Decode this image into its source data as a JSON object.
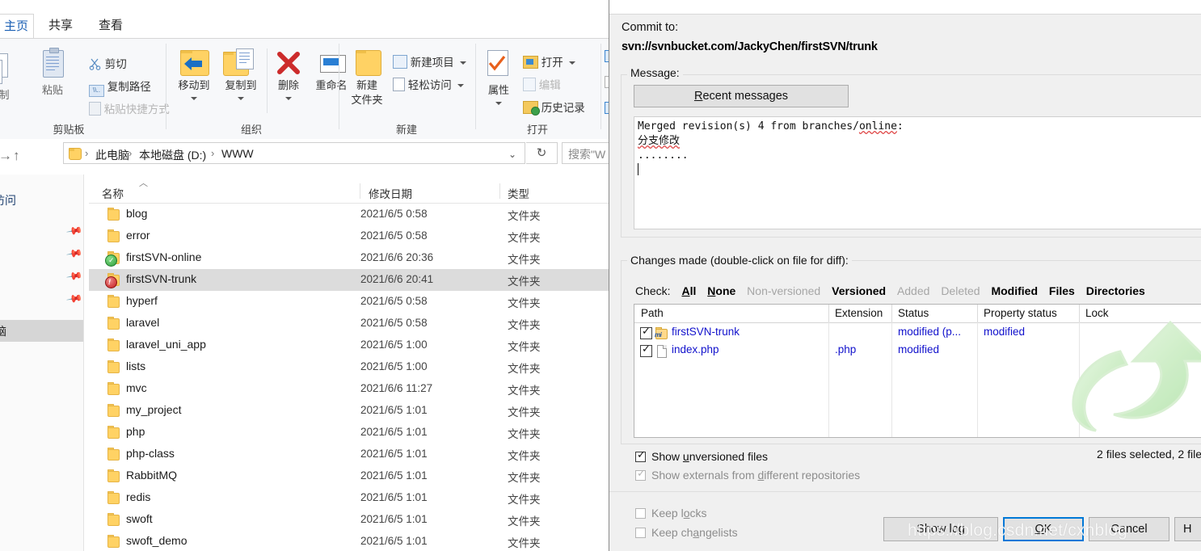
{
  "explorer": {
    "tabs": [
      {
        "id": "home",
        "label": "主页",
        "active": true
      },
      {
        "id": "share",
        "label": "共享",
        "active": false
      },
      {
        "id": "view",
        "label": "查看",
        "active": false
      }
    ],
    "ribbon_groups": [
      {
        "name": "clipboard",
        "label": "剪贴板"
      },
      {
        "name": "organize",
        "label": "组织"
      },
      {
        "name": "new",
        "label": "新建"
      },
      {
        "name": "open",
        "label": "打开"
      }
    ],
    "ribbon_buttons": {
      "copy": "制",
      "paste": "粘贴",
      "cut": "剪切",
      "copy_path": "复制路径",
      "paste_shortcut": "粘贴快捷方式",
      "move_to": "移动到",
      "copy_to": "复制到",
      "delete": "删除",
      "rename": "重命名",
      "new_folder_l1": "新建",
      "new_folder_l2": "文件夹",
      "new_item": "新建项目",
      "easy_access": "轻松访问",
      "properties": "属性",
      "open": "打开",
      "edit": "编辑",
      "history": "历史记录"
    },
    "addressbar": {
      "breadcrumbs": [
        "此电脑",
        "本地磁盘 (D:)",
        "WWW"
      ],
      "separator": "›",
      "chevron": "⌄",
      "refresh_glyph": "↻",
      "search_placeholder": "搜索\"W"
    },
    "columns": [
      "名称",
      "修改日期",
      "类型"
    ],
    "nav_pane": {
      "header": "访问",
      "selected_item": "脑"
    },
    "files": [
      {
        "name": "blog",
        "date": "2021/6/5 0:58",
        "type": "文件夹",
        "overlay": "none",
        "selected": false
      },
      {
        "name": "error",
        "date": "2021/6/5 0:58",
        "type": "文件夹",
        "overlay": "none",
        "selected": false
      },
      {
        "name": "firstSVN-online",
        "date": "2021/6/6 20:36",
        "type": "文件夹",
        "overlay": "green",
        "selected": false
      },
      {
        "name": "firstSVN-trunk",
        "date": "2021/6/6 20:41",
        "type": "文件夹",
        "overlay": "red",
        "selected": true
      },
      {
        "name": "hyperf",
        "date": "2021/6/5 0:58",
        "type": "文件夹",
        "overlay": "none",
        "selected": false
      },
      {
        "name": "laravel",
        "date": "2021/6/5 0:58",
        "type": "文件夹",
        "overlay": "none",
        "selected": false
      },
      {
        "name": "laravel_uni_app",
        "date": "2021/6/5 1:00",
        "type": "文件夹",
        "overlay": "none",
        "selected": false
      },
      {
        "name": "lists",
        "date": "2021/6/5 1:00",
        "type": "文件夹",
        "overlay": "none",
        "selected": false
      },
      {
        "name": "mvc",
        "date": "2021/6/6 11:27",
        "type": "文件夹",
        "overlay": "none",
        "selected": false
      },
      {
        "name": "my_project",
        "date": "2021/6/5 1:01",
        "type": "文件夹",
        "overlay": "none",
        "selected": false
      },
      {
        "name": "php",
        "date": "2021/6/5 1:01",
        "type": "文件夹",
        "overlay": "none",
        "selected": false
      },
      {
        "name": "php-class",
        "date": "2021/6/5 1:01",
        "type": "文件夹",
        "overlay": "none",
        "selected": false
      },
      {
        "name": "RabbitMQ",
        "date": "2021/6/5 1:01",
        "type": "文件夹",
        "overlay": "none",
        "selected": false
      },
      {
        "name": "redis",
        "date": "2021/6/5 1:01",
        "type": "文件夹",
        "overlay": "none",
        "selected": false
      },
      {
        "name": "swoft",
        "date": "2021/6/5 1:01",
        "type": "文件夹",
        "overlay": "none",
        "selected": false
      },
      {
        "name": "swoft_demo",
        "date": "2021/6/5 1:01",
        "type": "文件夹",
        "overlay": "none",
        "selected": false
      }
    ]
  },
  "svn_dialog": {
    "commit_to_label": "Commit to:",
    "commit_to_url": "svn://svnbucket.com/JackyChen/firstSVN/trunk",
    "message_group_title": "Message:",
    "recent_messages_button": "Recent messages",
    "message_lines": [
      "Merged revision(s) 4 from branches/online:",
      "分支修改",
      "........"
    ],
    "changes_group_title": "Changes made (double-click on file for diff):",
    "check_label": "Check:",
    "check_links": [
      {
        "label": "All",
        "enabled": true,
        "accel": "A"
      },
      {
        "label": "None",
        "enabled": true,
        "accel": "N"
      },
      {
        "label": "Non-versioned",
        "enabled": false,
        "accel": ""
      },
      {
        "label": "Versioned",
        "enabled": true,
        "accel": ""
      },
      {
        "label": "Added",
        "enabled": false,
        "accel": ""
      },
      {
        "label": "Deleted",
        "enabled": false,
        "accel": ""
      },
      {
        "label": "Modified",
        "enabled": true,
        "accel": ""
      },
      {
        "label": "Files",
        "enabled": true,
        "accel": ""
      },
      {
        "label": "Directories",
        "enabled": true,
        "accel": ""
      }
    ],
    "list_columns": [
      "Path",
      "Extension",
      "Status",
      "Property status",
      "Lock"
    ],
    "list_rows": [
      {
        "checked": true,
        "icon": "folder-modified",
        "path": "firstSVN-trunk",
        "extension": "",
        "status": "modified (p...",
        "property_status": "modified",
        "lock": ""
      },
      {
        "checked": true,
        "icon": "file",
        "path": "index.php",
        "extension": ".php",
        "status": "modified",
        "property_status": "",
        "lock": ""
      }
    ],
    "options": [
      {
        "id": "show-unversioned",
        "label": "Show unversioned files",
        "checked": true,
        "enabled": true
      },
      {
        "id": "show-externals",
        "label": "Show externals from different repositories",
        "checked": true,
        "enabled": false
      },
      {
        "id": "keep-locks",
        "label": "Keep locks",
        "checked": false,
        "enabled": false
      },
      {
        "id": "keep-changelists",
        "label": "Keep changelists",
        "checked": false,
        "enabled": false
      }
    ],
    "selection_status": "2 files selected, 2 file",
    "buttons": [
      {
        "id": "show-log",
        "label": "Show log",
        "default": false
      },
      {
        "id": "ok",
        "label": "OK",
        "default": true
      },
      {
        "id": "cancel",
        "label": "Cancel",
        "default": false
      },
      {
        "id": "help",
        "label": "H",
        "default": false
      }
    ]
  },
  "watermark": "https://blog.csdn.net/cxnblog"
}
